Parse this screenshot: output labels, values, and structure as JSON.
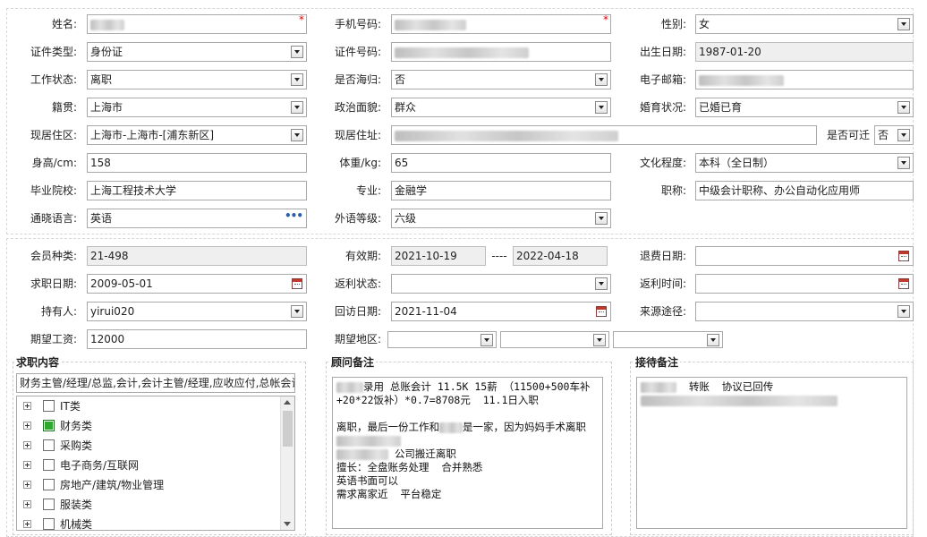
{
  "basic": {
    "name_label": "姓名:",
    "mobile_label": "手机号码:",
    "gender_label": "性别:",
    "gender_value": "女",
    "id_type_label": "证件类型:",
    "id_type_value": "身份证",
    "id_no_label": "证件号码:",
    "birth_label": "出生日期:",
    "birth_value": "1987-01-20",
    "work_status_label": "工作状态:",
    "work_status_value": "离职",
    "returnee_label": "是否海归:",
    "returnee_value": "否",
    "email_label": "电子邮箱:",
    "native_label": "籍贯:",
    "native_value": "上海市",
    "political_label": "政治面貌:",
    "political_value": "群众",
    "marital_label": "婚育状况:",
    "marital_value": "已婚已育",
    "residence_label": "现居住区:",
    "residence_value": "上海市-上海市-[浦东新区]",
    "address_label": "现居住址:",
    "relocate_label": "是否可迁",
    "relocate_value": "否",
    "height_label": "身高/cm:",
    "height_value": "158",
    "weight_label": "体重/kg:",
    "weight_value": "65",
    "education_label": "文化程度:",
    "education_value": "本科（全日制）",
    "school_label": "毕业院校:",
    "school_value": "上海工程技术大学",
    "major_label": "专业:",
    "major_value": "金融学",
    "title_label": "职称:",
    "title_value": "中级会计职称、办公自动化应用师",
    "language_label": "通晓语言:",
    "language_value": "英语",
    "language_more": "•••",
    "foreign_level_label": "外语等级:",
    "foreign_level_value": "六级",
    "required_mark": "*"
  },
  "membership": {
    "member_type_label": "会员种类:",
    "member_type_value": "21-498",
    "valid_label": "有效期:",
    "valid_from": "2021-10-19",
    "valid_sep": "----",
    "valid_to": "2022-04-18",
    "refund_date_label": "退费日期:",
    "job_date_label": "求职日期:",
    "job_date_value": "2009-05-01",
    "rebate_status_label": "返利状态:",
    "rebate_time_label": "返利时间:",
    "holder_label": "持有人:",
    "holder_value": "yirui020",
    "visit_date_label": "回访日期:",
    "visit_date_value": "2021-11-04",
    "source_label": "来源途径:",
    "salary_label": "期望工资:",
    "salary_value": "12000",
    "region_label": "期望地区:"
  },
  "job_content": {
    "title": "求职内容",
    "selected_text": "财务主管/经理/总监,会计,会计主管/经理,应收应付,总帐会计",
    "categories": [
      {
        "label": "IT类",
        "checked": false
      },
      {
        "label": "财务类",
        "checked": true
      },
      {
        "label": "采购类",
        "checked": false
      },
      {
        "label": "电子商务/互联网",
        "checked": false
      },
      {
        "label": "房地产/建筑/物业管理",
        "checked": false
      },
      {
        "label": "服装类",
        "checked": false
      },
      {
        "label": "机械类",
        "checked": false
      }
    ]
  },
  "consultant_notes": {
    "title": "顾问备注",
    "line1": "录用 总账会计 11.5K 15薪 （11500+500车补",
    "line2": "+20*22饭补）*0.7=8708元  11.1日入职",
    "line3": "",
    "line4a": "离职，最后一份工作和",
    "line4b": "是一家，因为妈妈手术离职",
    "line6": "公司搬迁离职",
    "line7": "擅长：全盘账务处理  合并熟悉",
    "line8": "英语书面可以",
    "line9": "需求离家近  平台稳定"
  },
  "reception_notes": {
    "title": "接待备注",
    "line1": "转账  协议已回传"
  }
}
